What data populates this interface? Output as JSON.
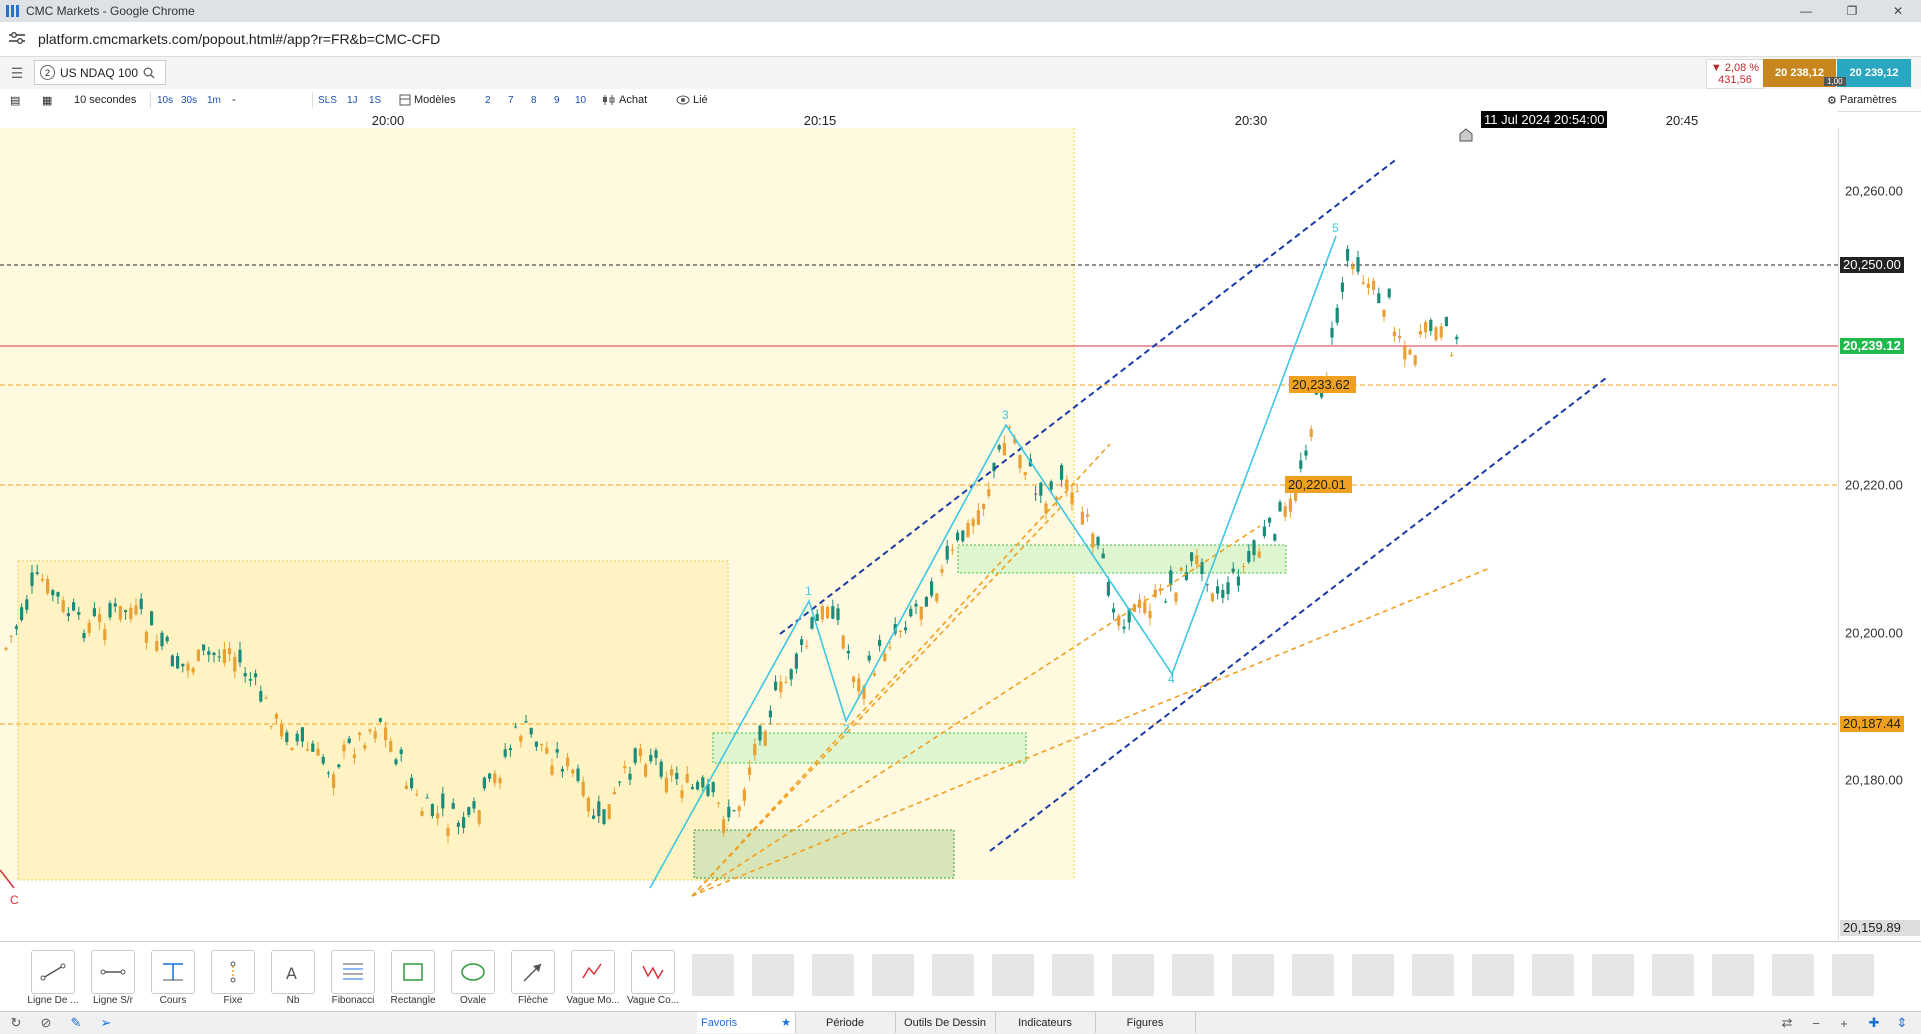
{
  "browser": {
    "window_title": "CMC Markets - Google Chrome",
    "url": "platform.cmcmarkets.com/popout.html#/app?r=FR&b=CMC-CFD"
  },
  "instrument": {
    "tab_number": "2",
    "name": "US NDAQ 100",
    "change_pct": "▼ 2,08 %",
    "change_pts": "431,56",
    "sell_price": "20 238,12",
    "buy_price": "20 239,12",
    "spread": "1,00"
  },
  "toolbar": {
    "interval": "10 secondes",
    "interval_buttons": [
      "10s",
      "30s",
      "1m",
      "-"
    ],
    "range_buttons": [
      "SLS",
      "1J",
      "1S"
    ],
    "models_label": "Modèles",
    "count_buttons": [
      "2",
      "7",
      "8",
      "9",
      "10"
    ],
    "buy_label": "Achat",
    "linked_label": "Lié",
    "settings_label": "Paramètres"
  },
  "time_axis": {
    "labels": [
      "20:00",
      "20:15",
      "20:30",
      "20:45"
    ],
    "crosshair_time": "11 Jul 2024 20:54:00"
  },
  "price_axis": {
    "labels": [
      "20,260.00",
      "20,220.00",
      "20,200.00",
      "20,180.00"
    ],
    "tags": {
      "hline_dark": "20,250.00",
      "current": "20,239.12",
      "orange_low": "20,187.44",
      "bottom": "20,159.89"
    }
  },
  "chart_annotations": {
    "price_tag_upper": "20,233.62",
    "price_tag_lower": "20,220.01",
    "wave_labels": [
      "1",
      "2",
      "3",
      "4",
      "5"
    ],
    "corner_label": "C"
  },
  "colors": {
    "up": "#1a8c7a",
    "down": "#e8a132",
    "wave": "#3ec7e0",
    "trend_blue": "#1a3aa8",
    "orange_dash": "#f0a020",
    "current_line": "#d9343f",
    "current_tag": "#1fb94c"
  },
  "drawing_tools": [
    {
      "label": "Ligne De ...",
      "icon": "line-icon"
    },
    {
      "label": "Ligne S/r",
      "icon": "hline-icon"
    },
    {
      "label": "Cours",
      "icon": "price-icon"
    },
    {
      "label": "Fixe",
      "icon": "vline-icon"
    },
    {
      "label": "Nb",
      "icon": "text-icon"
    },
    {
      "label": "Fibonacci",
      "icon": "fibonacci-icon"
    },
    {
      "label": "Rectangle",
      "icon": "rectangle-icon"
    },
    {
      "label": "Ovale",
      "icon": "oval-icon"
    },
    {
      "label": "Flèche",
      "icon": "arrow-icon"
    },
    {
      "label": "Vague Mo...",
      "icon": "wave-icon"
    },
    {
      "label": "Vague Co...",
      "icon": "wave-corrective-icon"
    }
  ],
  "bottom_tabs": [
    "Favoris",
    "Période",
    "Outils De Dessin",
    "Indicateurs",
    "Figures"
  ]
}
